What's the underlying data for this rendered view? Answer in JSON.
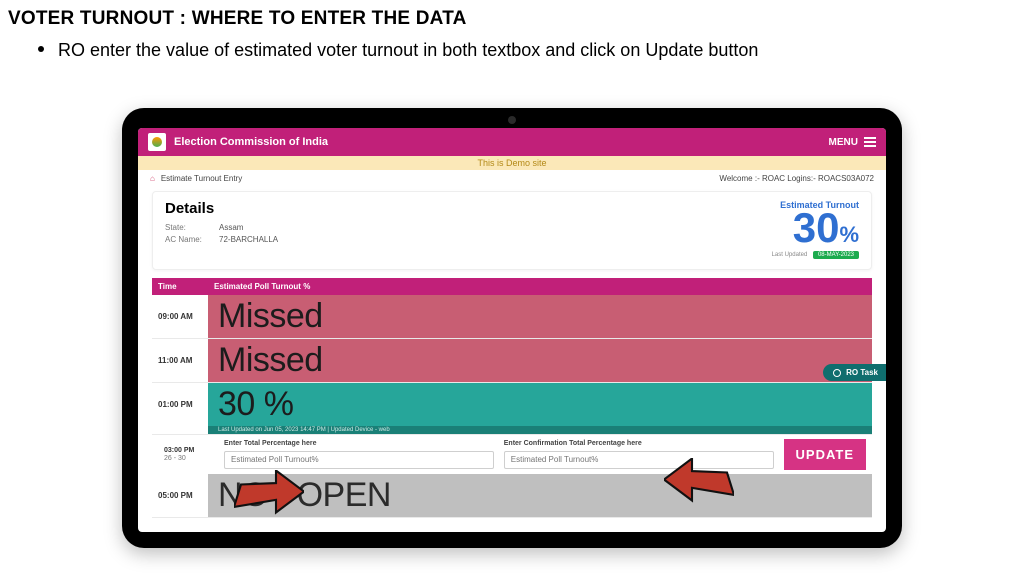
{
  "doc": {
    "title": "VOTER TURNOUT : WHERE TO ENTER THE DATA",
    "bullet": "RO enter the value of estimated voter turnout in both textbox and click on Update button"
  },
  "topbar": {
    "title": "Election Commission of India",
    "menu": "MENU"
  },
  "demo_strip": "This is Demo site",
  "crumb": {
    "page": "Estimate Turnout Entry",
    "welcome": "Welcome :- ROAC Logins:- ROACS03A072"
  },
  "details": {
    "heading": "Details",
    "state_k": "State:",
    "state_v": "Assam",
    "ac_k": "AC Name:",
    "ac_v": "72-BARCHALLA",
    "est_label": "Estimated Turnout",
    "est_value": "30",
    "est_pct": "%",
    "last_updated": "Last Updated",
    "chip": "08-MAY-2023"
  },
  "grid": {
    "head_time": "Time",
    "head_val": "Estimated Poll Turnout %",
    "rows": [
      {
        "time": "09:00 AM",
        "status": "Missed",
        "kind": "missed"
      },
      {
        "time": "11:00 AM",
        "status": "Missed",
        "kind": "missed"
      },
      {
        "time": "01:00 PM",
        "status": "30 %",
        "kind": "percent",
        "foot": "Last Updated on Jun 05, 2023 14:47 PM  |  Updated Device - web"
      },
      {
        "time": "03:00 PM",
        "kind": "entry",
        "range": "26 - 30",
        "f1_label": "Enter Total Percentage here",
        "f1_ph": "Estimated Poll Turnout%",
        "f2_label": "Enter Confirmation Total Percentage here",
        "f2_ph": "Estimated Poll Turnout%",
        "btn": "UPDATE"
      },
      {
        "time": "05:00 PM",
        "status": "NOT OPEN",
        "kind": "notopen"
      }
    ]
  },
  "side_pill": "RO Task"
}
